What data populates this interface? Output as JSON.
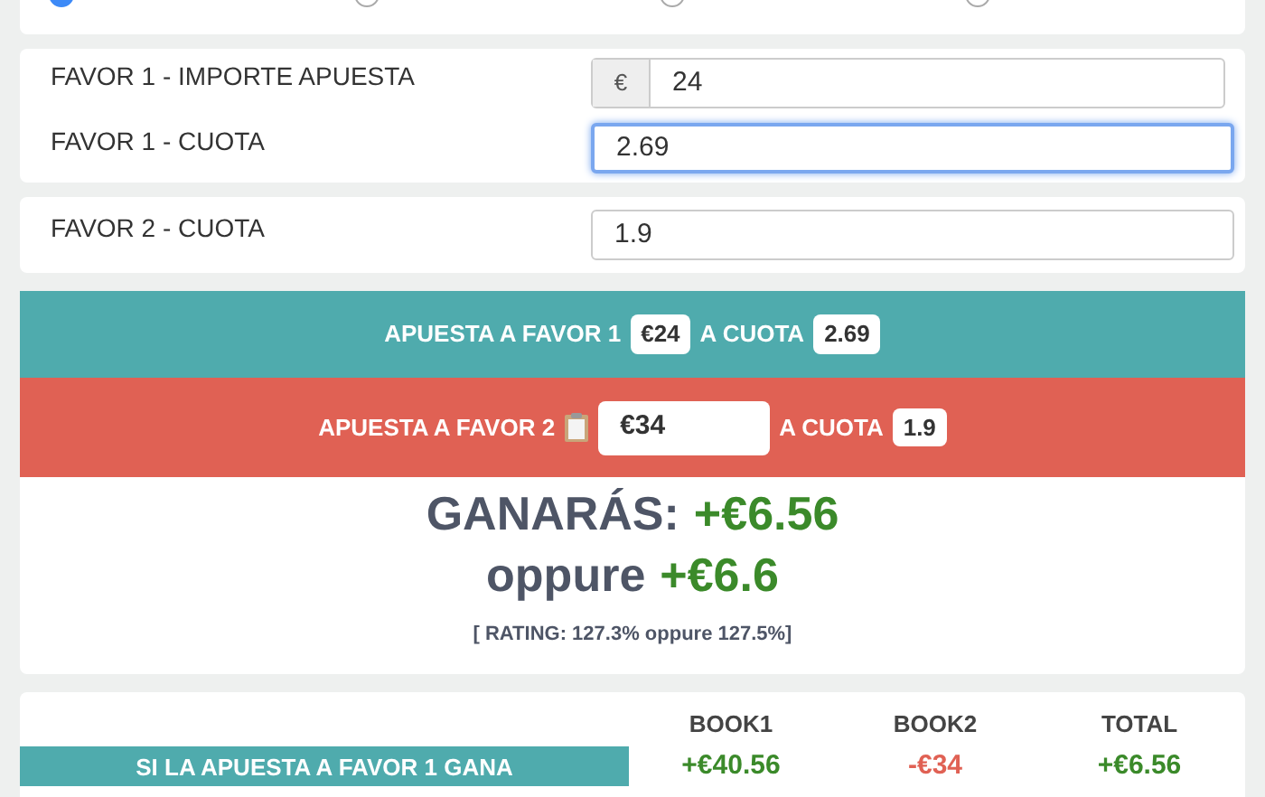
{
  "options": [
    {
      "selected": true
    },
    {
      "selected": false
    },
    {
      "selected": false
    },
    {
      "selected": false
    }
  ],
  "stake_card": {
    "fields": [
      {
        "label": "FAVOR 1 - IMPORTE APUESTA",
        "prefix": "€",
        "value": "24",
        "focused": false
      },
      {
        "label": "FAVOR 1 - CUOTA",
        "value": "2.69",
        "focused": true
      }
    ]
  },
  "odds2_card": {
    "fields": [
      {
        "label": "FAVOR 2 - CUOTA",
        "value": "1.9",
        "focused": false
      }
    ]
  },
  "bet1": {
    "label": "APUESTA A FAVOR 1",
    "amount": "€24",
    "odds_label": "A CUOTA",
    "odds": "2.69"
  },
  "bet2": {
    "label": "APUESTA A FAVOR 2",
    "amount": "€34",
    "odds_label": "A CUOTA",
    "odds": "1.9"
  },
  "result": {
    "label": "GANARÁS:",
    "profit": "+€6.56",
    "alt_label": "oppure",
    "alt_profit": "+€6.6",
    "rating": "[ RATING: 127.3% oppure 127.5%]"
  },
  "table": {
    "columns": [
      "BOOK1",
      "BOOK2",
      "TOTAL"
    ],
    "rows": [
      {
        "label": "SI LA APUESTA A FAVOR 1 GANA",
        "cells": [
          {
            "value": "+€40.56",
            "positive": true
          },
          {
            "value": "-€34",
            "positive": false
          },
          {
            "value": "+€6.56",
            "positive": true
          }
        ]
      }
    ]
  }
}
